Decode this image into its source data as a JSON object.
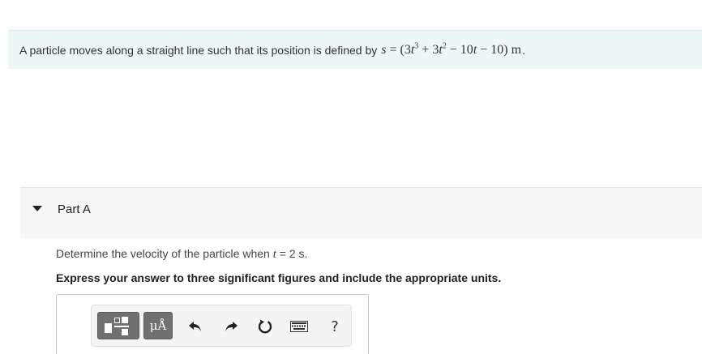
{
  "problem": {
    "intro_text": "A particle moves along a straight line such that its position is defined by",
    "equation": {
      "lhs_var": "s",
      "equals": "=",
      "open": "(3",
      "t1": "t",
      "exp1": "3",
      "plus_3": " + 3",
      "t2": "t",
      "exp2": "2",
      "minus_10": " − 10",
      "t3": "t",
      "minus_10_close": " − 10)",
      "unit": "m"
    },
    "period": "."
  },
  "part": {
    "title": "Part A",
    "question_prefix": "Determine the velocity of the particle when",
    "question_var": "t",
    "question_suffix": "= 2 s.",
    "instruction": "Express your answer to three significant figures and include the appropriate units."
  },
  "toolbar": {
    "units_label": "μÅ",
    "help_label": "?",
    "icons": [
      "templates-icon",
      "units-icon",
      "undo-icon",
      "redo-icon",
      "reset-icon",
      "keyboard-icon",
      "help-icon"
    ]
  }
}
